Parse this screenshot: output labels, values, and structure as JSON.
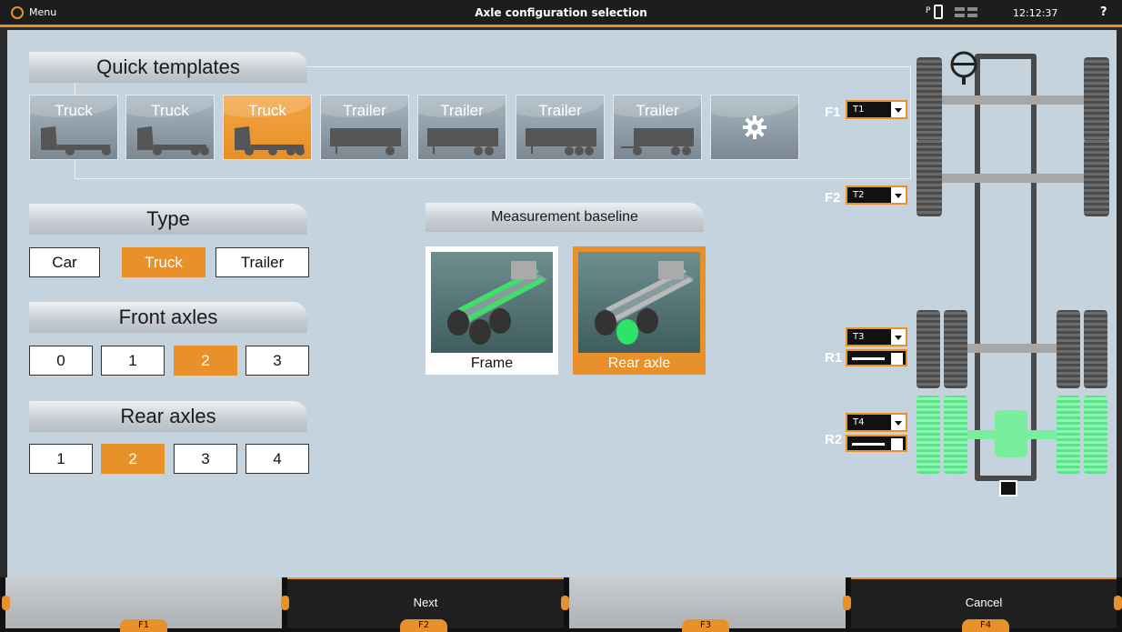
{
  "header": {
    "menu_label": "Menu",
    "title": "Axle configuration selection",
    "status_p": "P",
    "time": "12:12:37",
    "help": "?"
  },
  "quick_templates": {
    "title": "Quick templates",
    "items": [
      {
        "label": "Truck",
        "active": false,
        "icon": "truck-2axle-icon"
      },
      {
        "label": "Truck",
        "active": false,
        "icon": "truck-3axle-icon"
      },
      {
        "label": "Truck",
        "active": true,
        "icon": "truck-4axle-icon"
      },
      {
        "label": "Trailer",
        "active": false,
        "icon": "trailer-1axle-icon"
      },
      {
        "label": "Trailer",
        "active": false,
        "icon": "trailer-2axle-icon"
      },
      {
        "label": "Trailer",
        "active": false,
        "icon": "trailer-3axle-icon"
      },
      {
        "label": "Trailer",
        "active": false,
        "icon": "drawbar-trailer-icon"
      }
    ],
    "settings_icon": "gear-icon"
  },
  "type": {
    "title": "Type",
    "options": [
      "Car",
      "Truck",
      "Trailer"
    ],
    "selected": "Truck"
  },
  "front_axles": {
    "title": "Front axles",
    "options": [
      "0",
      "1",
      "2",
      "3"
    ],
    "selected": "2"
  },
  "rear_axles": {
    "title": "Rear axles",
    "options": [
      "1",
      "2",
      "3",
      "4"
    ],
    "selected": "2"
  },
  "measurement_baseline": {
    "title": "Measurement baseline",
    "options": [
      {
        "label": "Frame",
        "selected": false
      },
      {
        "label": "Rear axle",
        "selected": true
      }
    ]
  },
  "axles": [
    {
      "tag": "F1",
      "value": "T1"
    },
    {
      "tag": "F2",
      "value": "T2"
    },
    {
      "tag": "R1",
      "value": "T3"
    },
    {
      "tag": "R2",
      "value": "T4"
    }
  ],
  "footer": {
    "keys": [
      {
        "key": "F1",
        "label": ""
      },
      {
        "key": "F2",
        "label": "Next"
      },
      {
        "key": "F3",
        "label": ""
      },
      {
        "key": "F4",
        "label": "Cancel"
      }
    ]
  },
  "colors": {
    "accent": "#e8902a",
    "panel_bg": "#c4d3de",
    "highlight_axle": "#79ee9f"
  }
}
